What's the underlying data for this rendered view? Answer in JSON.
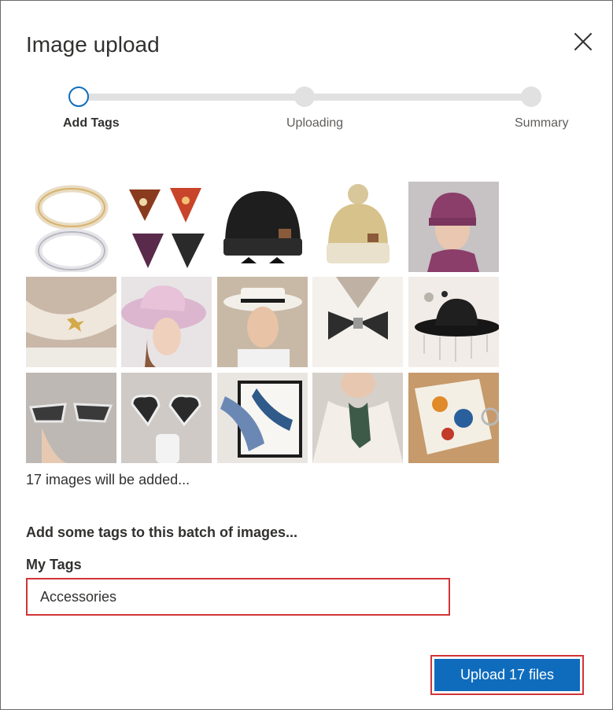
{
  "dialog": {
    "title": "Image upload",
    "close_icon": "close-icon"
  },
  "stepper": {
    "steps": [
      {
        "label": "Add Tags",
        "state": "active"
      },
      {
        "label": "Uploading",
        "state": "pending"
      },
      {
        "label": "Summary",
        "state": "pending"
      }
    ]
  },
  "images": {
    "thumbnails": [
      {
        "name": "pearl-buckles"
      },
      {
        "name": "bandana-scarves"
      },
      {
        "name": "black-beanie"
      },
      {
        "name": "beige-pompom-beanie"
      },
      {
        "name": "purple-beanie-model"
      },
      {
        "name": "neck-scarf-brooch"
      },
      {
        "name": "pink-derby-hat"
      },
      {
        "name": "white-visor-hat"
      },
      {
        "name": "sequin-bow-tie"
      },
      {
        "name": "black-cowboy-hat"
      },
      {
        "name": "crystal-sunglasses"
      },
      {
        "name": "heart-sunglasses"
      },
      {
        "name": "silk-scarf-box"
      },
      {
        "name": "green-neck-scarf"
      },
      {
        "name": "printed-silk-scarf"
      }
    ],
    "count_text": "17 images will be added..."
  },
  "tags": {
    "heading": "Add some tags to this batch of images...",
    "label": "My Tags",
    "value": "Accessories"
  },
  "actions": {
    "upload_label": "Upload 17 files"
  },
  "colors": {
    "accent": "#0f6cbd",
    "highlight": "#d13438"
  }
}
